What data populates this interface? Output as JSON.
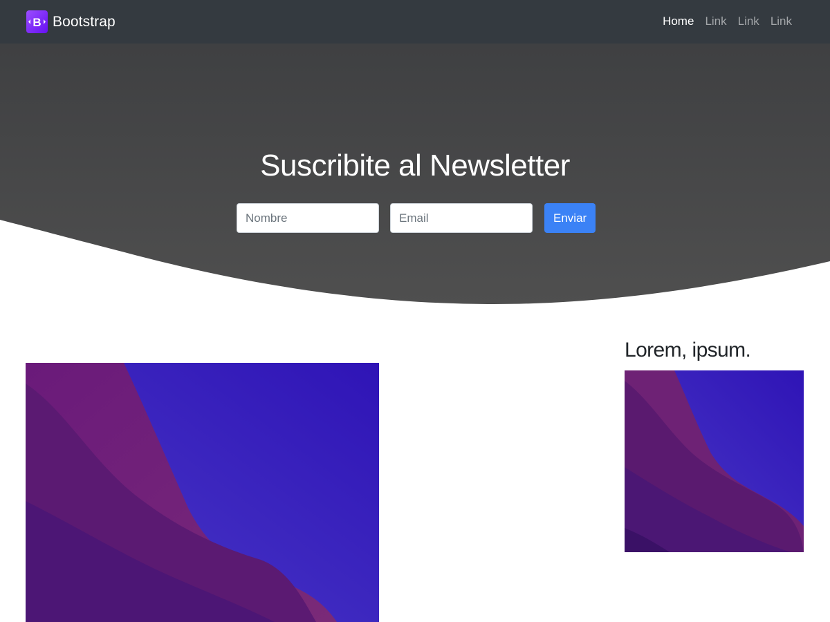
{
  "navbar": {
    "brand": "Bootstrap",
    "brand_logo_icon": "bootstrap-logo-icon",
    "links": [
      {
        "label": "Home",
        "active": true
      },
      {
        "label": "Link",
        "active": false
      },
      {
        "label": "Link",
        "active": false
      },
      {
        "label": "Link",
        "active": false
      }
    ]
  },
  "hero": {
    "title": "Suscribite al Newsletter",
    "name_placeholder": "Nombre",
    "email_placeholder": "Email",
    "submit_label": "Enviar"
  },
  "content": {
    "side_title": "Lorem, ipsum."
  },
  "colors": {
    "navbar_bg": "#343a40",
    "hero_bg": "#444444",
    "button": "#3b82f6",
    "brand_purple": "#7b2ff7"
  }
}
